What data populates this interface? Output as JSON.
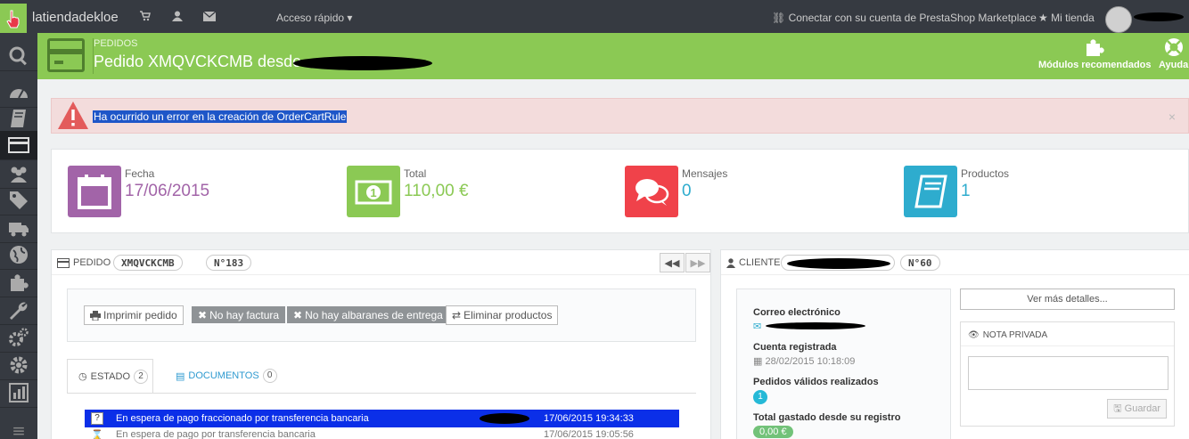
{
  "topbar": {
    "shop_name": "latiendadekloe",
    "quick_access": "Acceso rápido ▾",
    "marketplace": "Conectar con su cuenta de PrestaShop Marketplace",
    "my_shop": "Mi tienda",
    "icons": [
      "cart-icon",
      "user-icon",
      "envelope-icon"
    ]
  },
  "header": {
    "breadcrumb": "Pedidos",
    "title": "Pedido XMQVCKCMB desde",
    "recommended_modules": "Módulos recomendados",
    "help": "Ayuda"
  },
  "alert": {
    "message": "Ha ocurrido un error en la creación de OrderCartRule",
    "close": "×"
  },
  "kpis": [
    {
      "label": "Fecha",
      "value": "17/06/2015",
      "color": "#a264a8"
    },
    {
      "label": "Total",
      "value": "110,00 €",
      "color": "#8bc954"
    },
    {
      "label": "Mensajes",
      "value": "0",
      "color": "#f0424a"
    },
    {
      "label": "Productos",
      "value": "1",
      "color": "#2eacce"
    }
  ],
  "order_panel": {
    "title": "Pedido",
    "reference": "XMQVCKCMB",
    "number": "N°183",
    "buttons": {
      "print": "Imprimir pedido",
      "no_invoice": "No hay factura",
      "no_delivery": "No hay albaranes de entrega",
      "delete_products": "Eliminar productos"
    },
    "tabs": {
      "status_label": "ESTADO",
      "status_count": "2",
      "documents_label": "DOCUMENTOS",
      "documents_count": "0"
    },
    "history": [
      {
        "status": "En espera de pago fraccionado por transferencia bancaria",
        "date": "17/06/2015 19:34:33",
        "selected": true
      },
      {
        "status": "En espera de pago por transferencia bancaria",
        "date": "17/06/2015 19:05:56",
        "selected": false
      }
    ]
  },
  "client_panel": {
    "title": "Cliente",
    "number": "N°60",
    "email_label": "Correo electrónico",
    "registered_label": "Cuenta registrada",
    "registered_date": "28/02/2015 10:18:09",
    "valid_orders_label": "Pedidos válidos realizados",
    "valid_orders": "1",
    "total_spent_label": "Total gastado desde su registro",
    "total_spent": "0,00 €",
    "more_details": "Ver más detalles...",
    "private_note_title": "NOTA PRIVADA",
    "save": "Guardar"
  }
}
